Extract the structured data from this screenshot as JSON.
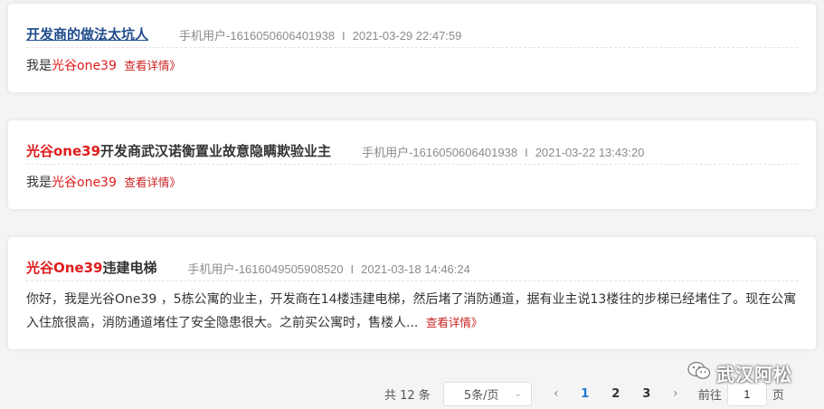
{
  "posts": [
    {
      "title": "开发商的做法太坑人",
      "user": "手机用户-1616050606401938",
      "sep": "I",
      "time": "2021-03-29 22:47:59",
      "body_prefix": "我是",
      "body_hl": "光谷one39",
      "more": "查看详情》"
    },
    {
      "title_hl": "光谷one39",
      "title_rest": "开发商武汉诺衡置业故意隐瞒欺验业主",
      "user": "手机用户-1616050606401938",
      "sep": "I",
      "time": "2021-03-22 13:43:20",
      "body_prefix": "我是",
      "body_hl": "光谷one39",
      "more": "查看详情》"
    },
    {
      "title_hl": "光谷One39",
      "title_rest": "违建电梯",
      "user": "手机用户-1616049505908520",
      "sep": "I",
      "time": "2021-03-18 14:46:24",
      "body": "你好，我是光谷One39 ，5栋公寓的业主，开发商在14楼违建电梯，然后堵了消防通道，据有业主说13楼往的步梯已经堵住了。现在公寓入住旅很高，消防通道堵住了安全隐患很大。之前买公寓时，售楼人...",
      "more": "查看详情》"
    }
  ],
  "pagination": {
    "total": "共 12 条",
    "page_size": "5条/页",
    "prev": "‹",
    "pages": [
      "1",
      "2",
      "3"
    ],
    "current": "1",
    "next": "›",
    "goto_label": "前往",
    "goto_value": "1",
    "goto_unit": "页"
  },
  "watermark": {
    "text": "武汉阿松",
    "icon": "wechat-icon"
  },
  "colors": {
    "highlight": "#e01c1c",
    "link_title": "#1f4b8c",
    "active_page": "#1e78d2",
    "more": "#cc2222"
  }
}
